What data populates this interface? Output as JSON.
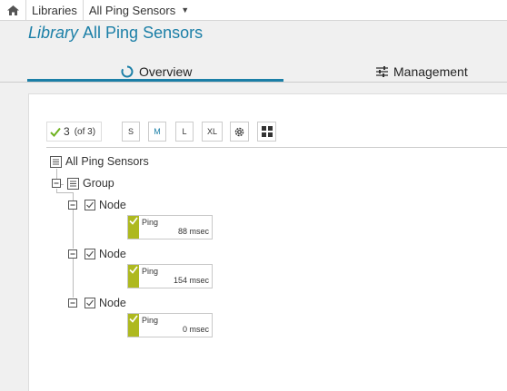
{
  "breadcrumb": {
    "items": [
      "Libraries",
      "All Ping Sensors"
    ]
  },
  "header": {
    "title_prefix": "Library",
    "title": "All Ping Sensors"
  },
  "tabs": [
    {
      "label": "Overview",
      "icon": "spinner-icon",
      "active": true
    },
    {
      "label": "Management",
      "icon": "sliders-icon",
      "active": false
    }
  ],
  "toolbar": {
    "selected_count": "3",
    "of_total": "(of 3)",
    "size_buttons": [
      "S",
      "M",
      "L",
      "XL"
    ],
    "active_size": "M"
  },
  "tree": {
    "root": "All Ping Sensors",
    "group": "Group",
    "nodes": [
      {
        "label": "Node",
        "sensor": {
          "name": "Ping",
          "value": "88 msec"
        }
      },
      {
        "label": "Node",
        "sensor": {
          "name": "Ping",
          "value": "154 msec"
        }
      },
      {
        "label": "Node",
        "sensor": {
          "name": "Ping",
          "value": "0 msec"
        }
      }
    ]
  },
  "colors": {
    "accent": "#1b7fa7",
    "sensor_ok": "#aeb91f",
    "check": "#6fb21f"
  }
}
